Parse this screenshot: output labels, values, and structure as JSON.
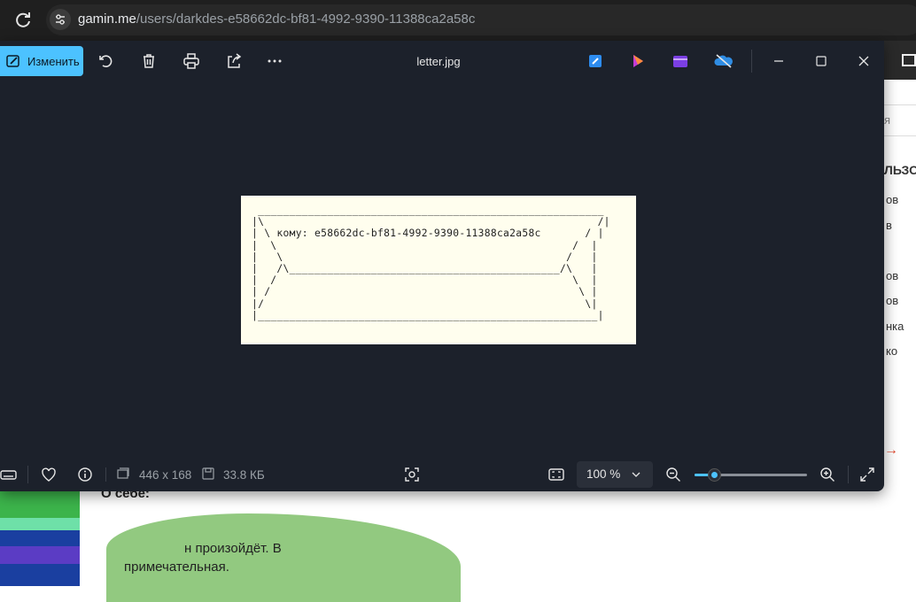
{
  "browser": {
    "url_domain": "gamin.me",
    "url_path": "/users/darkdes-e58662dc-bf81-4992-9390-11388ca2a58c"
  },
  "photos": {
    "edit_label": "Изменить",
    "file_title": "letter.jpg",
    "image_ascii": [
      " _______________________________________________________",
      "|\\                                                     /|",
      "| \\ кому: e58662dc-bf81-4992-9390-11388ca2a58c       / |",
      "|  \\                                               /  |",
      "|   \\                                             /   |",
      "|   /\\___________________________________________/\\   |",
      "|  /                                               \\  |",
      "| /                                                 \\ |",
      "|/                                                   \\|",
      "|______________________________________________________|"
    ],
    "status": {
      "dimensions": "446 x 168",
      "file_size": "33.8 КБ",
      "zoom": "100 %",
      "zoom_fraction": 0.17
    }
  },
  "background_page": {
    "search_fragment": "я",
    "section_title_fragment": "ЛЬЗОВ",
    "items": [
      "ов",
      "в",
      "ов",
      "ов",
      "нка",
      "ко"
    ],
    "about_label": "О себе:",
    "text_line1": "н      произойдёт. В",
    "text_line2": "примечательная."
  },
  "colors": {
    "accent": "#4cc2ff",
    "window_bg": "#1c212b",
    "image_bg": "#fffeee"
  }
}
